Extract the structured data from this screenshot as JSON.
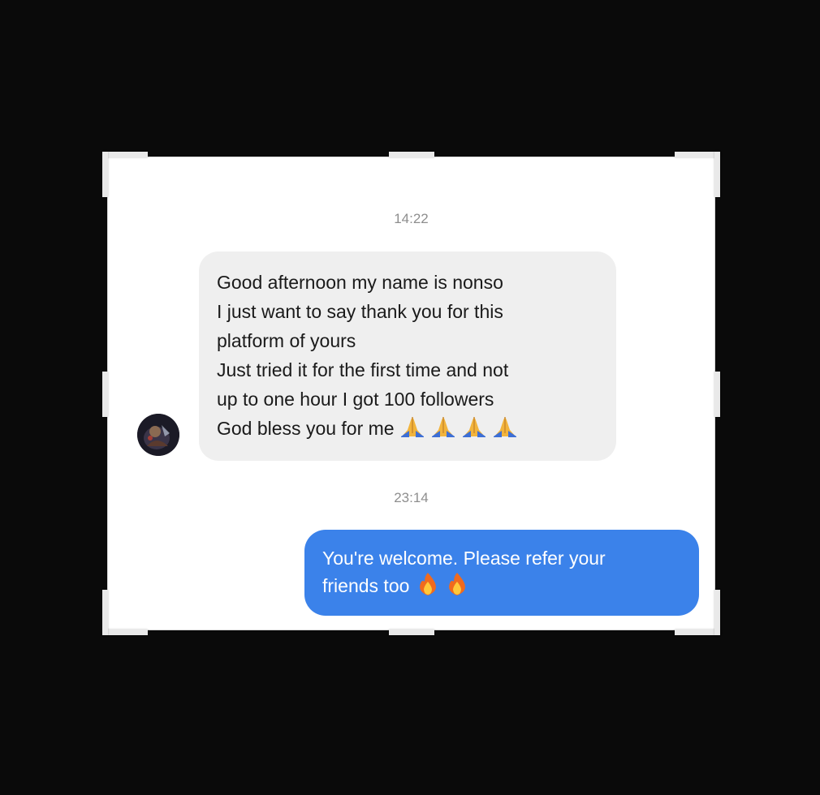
{
  "conversation": {
    "timestamps": [
      "14:22",
      "23:14"
    ],
    "incoming": {
      "sender_avatar_icon": "user-avatar",
      "lines": [
        "Good afternoon my name is nonso",
        "I just want to say thank you for this",
        "platform of yours",
        "Just tried it for the first time and not",
        "up to one hour I got 100 followers",
        "God bless you for me"
      ],
      "trailing_emoji_icon": "praying-hands-icon",
      "trailing_emoji_count": 4
    },
    "outgoing": {
      "lines": [
        "You're welcome. Please refer your",
        "friends too"
      ],
      "trailing_emoji_icon": "fire-icon",
      "trailing_emoji_count": 2
    }
  },
  "colors": {
    "background": "#0a0a0a",
    "incoming_bubble": "#efefef",
    "outgoing_bubble": "#3b82ea",
    "timestamp": "#8e8e8e"
  }
}
